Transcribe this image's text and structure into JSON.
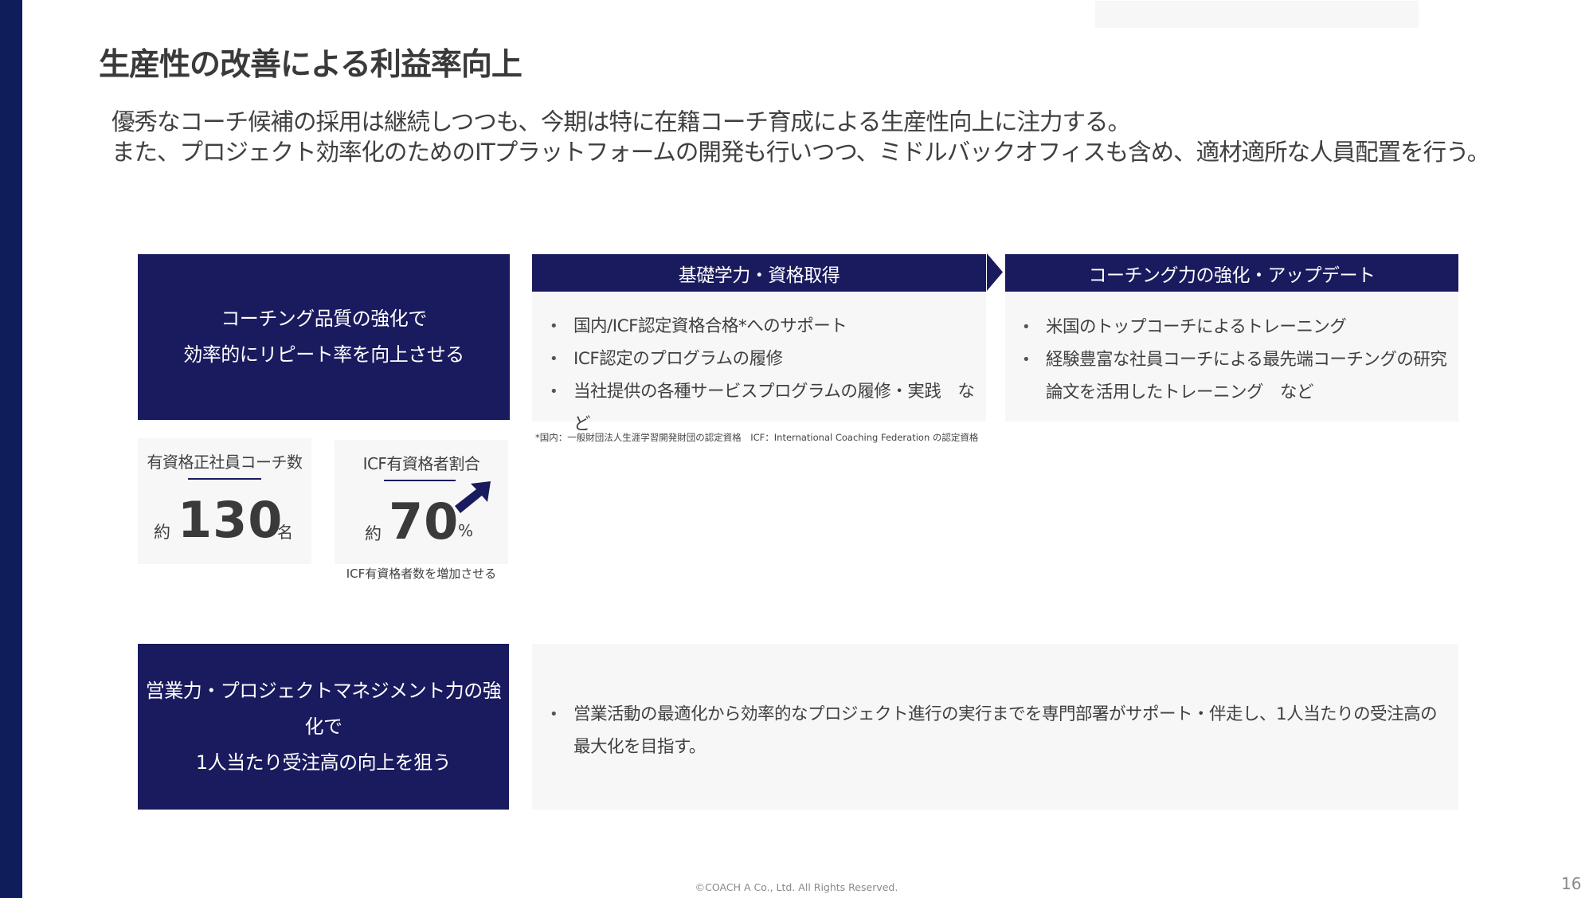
{
  "slide": {
    "title": "生産性の改善による利益率向上",
    "lead": [
      "優秀なコーチ候補の採用は継続しつつも、今期は特に在籍コーチ育成による生産性向上に注力する。",
      "また、プロジェクト効率化のためのITプラットフォームの開発も行いつつ、ミドルバックオフィスも含め、適材適所な人員配置を行う。"
    ],
    "colors": {
      "navy": "#1a1a5e",
      "left_bar": "#0f1d5a",
      "panel": "#f7f7f7"
    }
  },
  "block1": {
    "heading": [
      "コーチング品質の強化で",
      "効率的にリピート率を向上させる"
    ],
    "steps": [
      {
        "title": "基礎学力・資格取得",
        "items": [
          "国内/ICF認定資格合格*へのサポート",
          "ICF認定のプログラムの履修",
          "当社提供の各種サービスプログラムの履修・実践　など"
        ]
      },
      {
        "title": "コーチング力の強化・アップデート",
        "items": [
          "米国のトップコーチによるトレーニング",
          "経験豊富な社員コーチによる最先端コーチングの研究",
          "論文を活用したトレーニング　など"
        ]
      }
    ],
    "footnote": "*国内：一般財団法人生涯学習開発財団の認定資格　ICF：International Coaching Federation の認定資格",
    "stats": [
      {
        "label": "有資格正社員コーチ数",
        "prefix": "約",
        "value": "130",
        "unit": "名"
      },
      {
        "label": "ICF有資格者割合",
        "prefix": "約",
        "value": "70",
        "unit": "%",
        "trend_icon": "arrow-up-right-icon"
      }
    ],
    "stats_caption": "ICF有資格者数を増加させる"
  },
  "block2": {
    "heading": [
      "営業力・プロジェクトマネジメント力の強化で",
      "1人当たり受注高の向上を狙う"
    ],
    "items": [
      "営業活動の最適化から効率的なプロジェクト進行の実行までを専門部署がサポート・伴走し、1人当たりの受注高の最大化を目指す。"
    ]
  },
  "footer": {
    "copyright": "©COACH A Co., Ltd. All Rights Reserved.",
    "page_number": "16"
  }
}
